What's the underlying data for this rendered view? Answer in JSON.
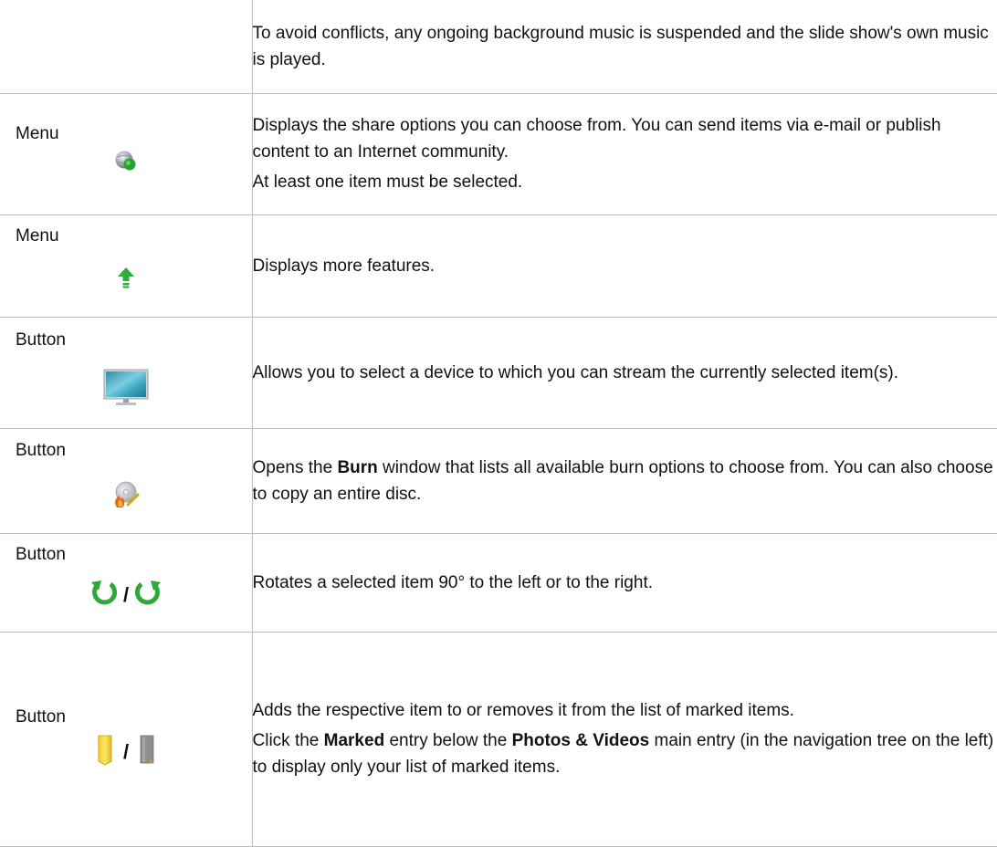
{
  "rows": [
    {
      "type": "",
      "description": [
        "To avoid conflicts, any ongoing background music is suspended and the slide show's own music is played."
      ]
    },
    {
      "type": "Menu",
      "icon": "share-globe-icon",
      "description": [
        "Displays the share options you can choose from. You can send items via e-mail or publish content to an Internet community.",
        "At least one item must be selected."
      ]
    },
    {
      "type": "Menu",
      "icon": "green-up-arrow-icon",
      "description": [
        "Displays more features."
      ]
    },
    {
      "type": "Button",
      "icon": "monitor-stream-icon",
      "description": [
        "Allows you to select a device to which you can stream the currently selected item(s)."
      ]
    },
    {
      "type": "Button",
      "icon": "burn-disc-icon",
      "desc_before": "Opens the ",
      "desc_bold": "Burn",
      "desc_after": " window that lists all available burn options to choose from. You can also choose to copy an entire disc."
    },
    {
      "type": "Button",
      "icon_left": "rotate-left-icon",
      "icon_right": "rotate-right-icon",
      "separator": "/",
      "description": [
        "Rotates a selected item 90° to the left or to the right."
      ]
    },
    {
      "type": "Button",
      "icon_left": "mark-yellow-icon",
      "icon_right": "unmark-gray-icon",
      "separator": "/",
      "description": [
        "Adds the respective item to or removes it from the list of marked items."
      ],
      "p2_a": "Click the ",
      "p2_b": "Marked",
      "p2_c": " entry below the ",
      "p2_d": "Photos & Videos",
      "p2_e": " main entry (in the navigation tree on the left) to display only your list of marked items."
    }
  ]
}
